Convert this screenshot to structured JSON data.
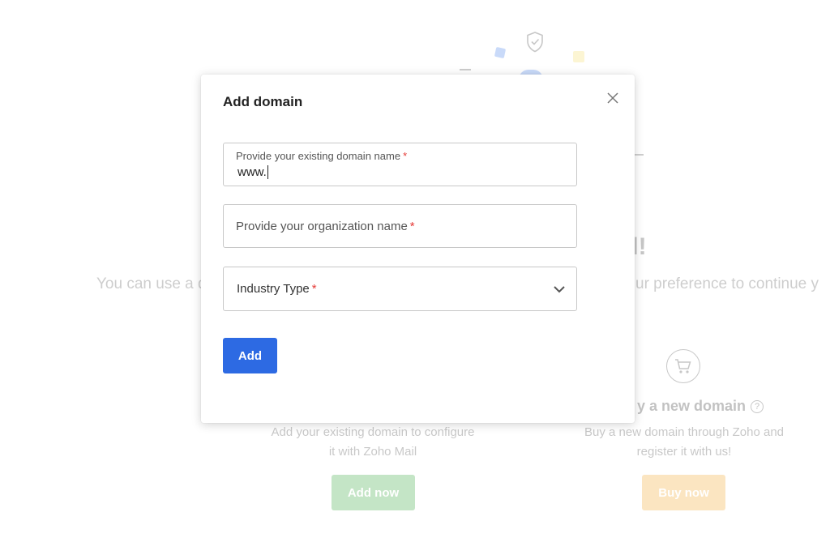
{
  "background": {
    "heading_fragment": "il!",
    "subtitle_left": "You can use a d",
    "subtitle_right": "ur preference to continue y",
    "buy_title": "y a new domain",
    "help_glyph": "?",
    "add_desc_line1": "Add your existing domain to configure",
    "add_desc_line2": "it with Zoho Mail",
    "buy_desc_line1": "Buy a new domain through Zoho and",
    "buy_desc_line2": "register it with us!",
    "add_now_label": "Add now",
    "buy_now_label": "Buy now",
    "colors": {
      "add_now": "#4caf50",
      "buy_now": "#f5b042"
    }
  },
  "modal": {
    "title": "Add domain",
    "close_icon": "close-icon",
    "domain_field": {
      "label": "Provide your existing domain name",
      "required_mark": "*",
      "value": "www."
    },
    "org_field": {
      "placeholder": "Provide your organization name",
      "required_mark": "*"
    },
    "industry_select": {
      "selected": "Industry Type",
      "required_mark": "*",
      "icon": "chevron-down-icon"
    },
    "add_button_label": "Add",
    "colors": {
      "primary": "#2d6ae3",
      "required": "#e53935"
    }
  }
}
